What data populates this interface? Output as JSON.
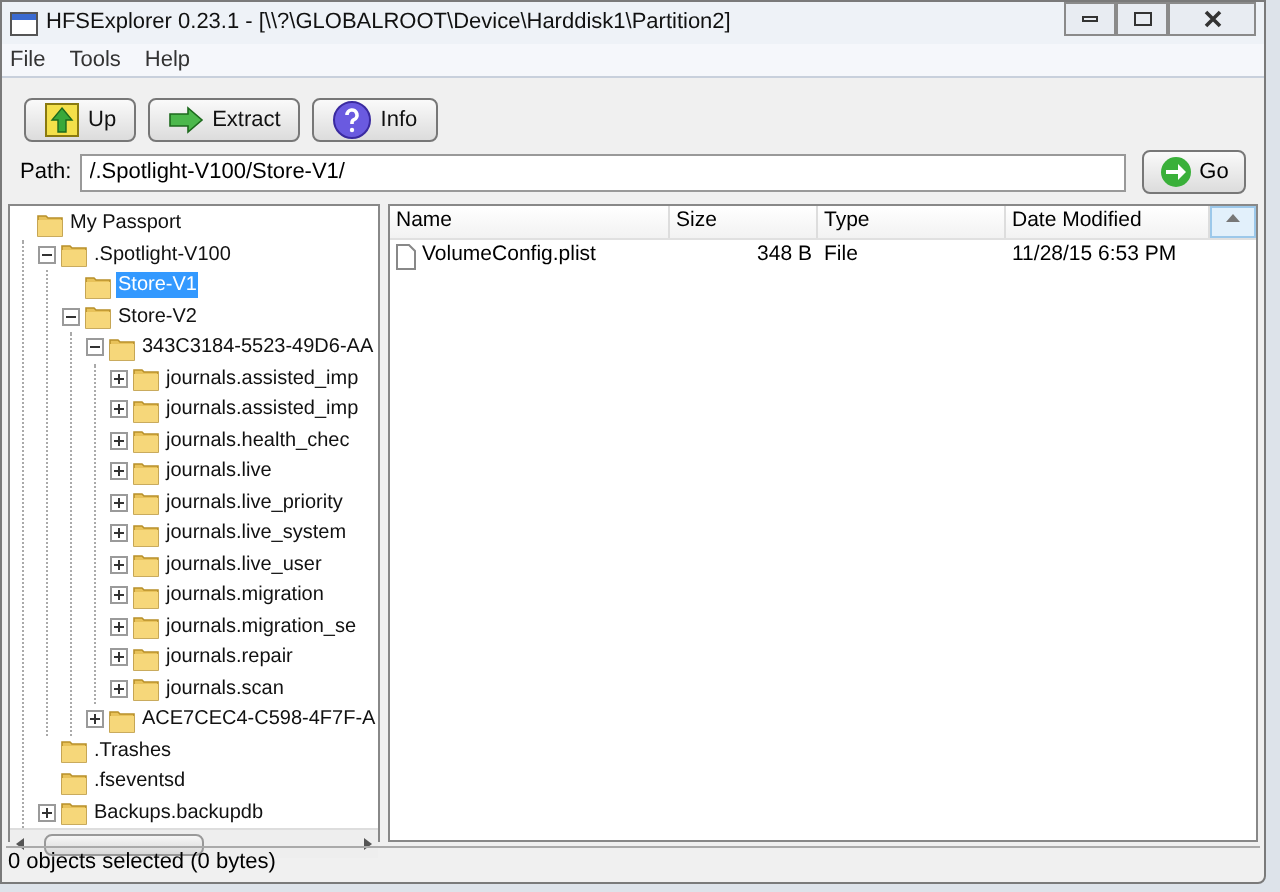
{
  "window": {
    "title": "HFSExplorer 0.23.1 - [\\\\?\\GLOBALROOT\\Device\\Harddisk1\\Partition2]"
  },
  "menu": [
    "File",
    "Tools",
    "Help"
  ],
  "toolbar": [
    {
      "label": "Up",
      "kind": "up"
    },
    {
      "label": "Extract",
      "kind": "extract"
    },
    {
      "label": "Info",
      "kind": "info"
    }
  ],
  "path": {
    "label": "Path:",
    "value": "/.Spotlight-V100/Store-V1/",
    "button": "Go"
  },
  "tree": [
    {
      "label": "My Passport",
      "selected": false,
      "children": [
        {
          "label": ".Spotlight-V100",
          "expanded": true,
          "selected": false,
          "children": [
            {
              "label": "Store-V1",
              "selected": true
            },
            {
              "label": "Store-V2",
              "expanded": true,
              "selected": false,
              "children": [
                {
                  "label": "343C3184-5523-49D6-AA",
                  "expanded": true,
                  "selected": false,
                  "children": [
                    {
                      "label": "journals.assisted_imp",
                      "expanded": false,
                      "selected": false
                    },
                    {
                      "label": "journals.assisted_imp",
                      "expanded": false,
                      "selected": false
                    },
                    {
                      "label": "journals.health_chec",
                      "expanded": false,
                      "selected": false
                    },
                    {
                      "label": "journals.live",
                      "expanded": false,
                      "selected": false
                    },
                    {
                      "label": "journals.live_priority",
                      "expanded": false,
                      "selected": false
                    },
                    {
                      "label": "journals.live_system",
                      "expanded": false,
                      "selected": false
                    },
                    {
                      "label": "journals.live_user",
                      "expanded": false,
                      "selected": false
                    },
                    {
                      "label": "journals.migration",
                      "expanded": false,
                      "selected": false
                    },
                    {
                      "label": "journals.migration_se",
                      "expanded": false,
                      "selected": false
                    },
                    {
                      "label": "journals.repair",
                      "expanded": false,
                      "selected": false
                    },
                    {
                      "label": "journals.scan",
                      "expanded": false,
                      "selected": false
                    }
                  ]
                },
                {
                  "label": "ACE7CEC4-C598-4F7F-A",
                  "expanded": false,
                  "selected": false
                }
              ]
            }
          ]
        },
        {
          "label": ".Trashes",
          "selected": false
        },
        {
          "label": ".fseventsd",
          "selected": false
        },
        {
          "label": "Backups.backupdb",
          "expanded": false,
          "selected": false
        }
      ]
    }
  ],
  "table": {
    "columns": [
      "Name",
      "Size",
      "Type",
      "Date Modified"
    ],
    "rows": [
      {
        "name": "VolumeConfig.plist",
        "size": "348 B",
        "type": "File",
        "date_modified": "11/28/15 6:53 PM"
      }
    ]
  },
  "status_bar": "0 objects selected (0 bytes)"
}
